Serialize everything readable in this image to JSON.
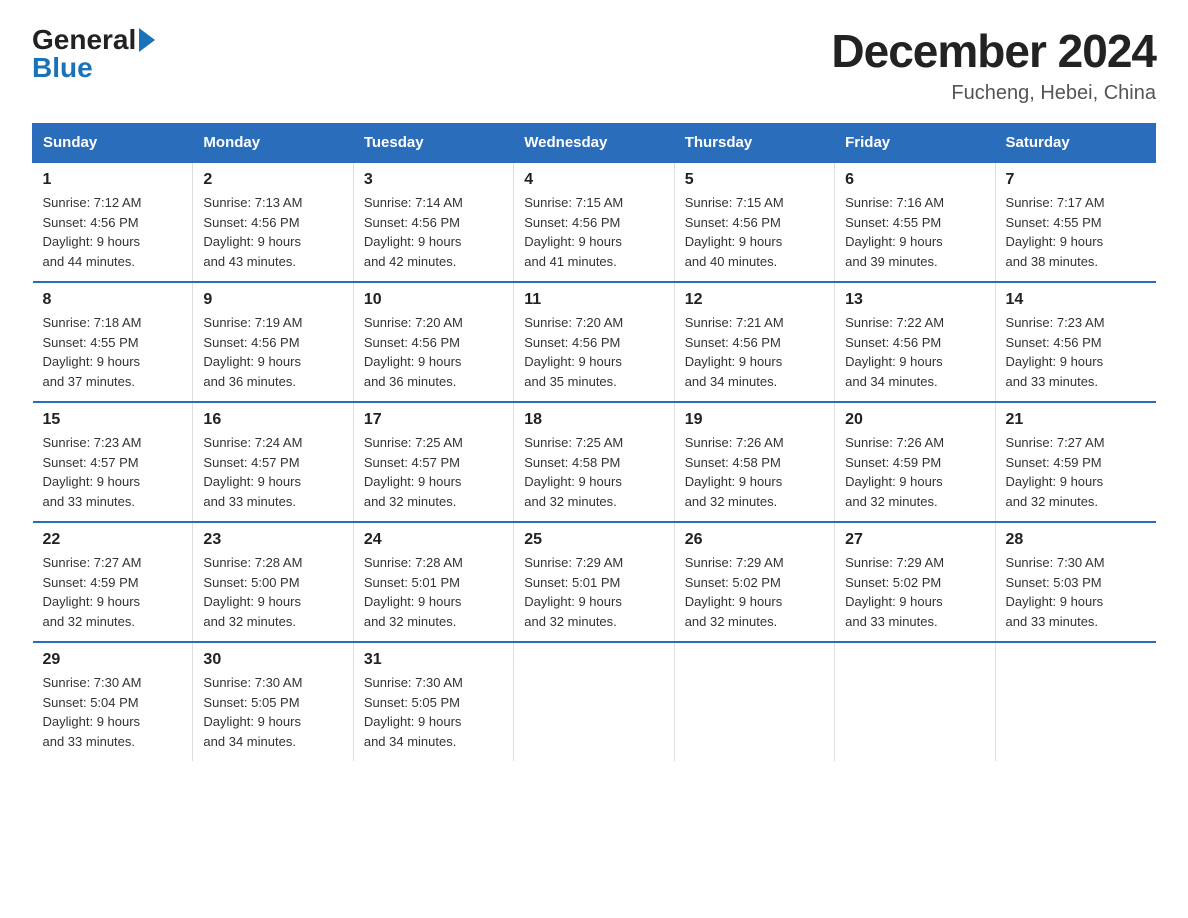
{
  "header": {
    "logo_general": "General",
    "logo_blue": "Blue",
    "month_title": "December 2024",
    "location": "Fucheng, Hebei, China"
  },
  "weekdays": [
    "Sunday",
    "Monday",
    "Tuesday",
    "Wednesday",
    "Thursday",
    "Friday",
    "Saturday"
  ],
  "weeks": [
    [
      {
        "day": "1",
        "sunrise": "7:12 AM",
        "sunset": "4:56 PM",
        "daylight": "9 hours and 44 minutes."
      },
      {
        "day": "2",
        "sunrise": "7:13 AM",
        "sunset": "4:56 PM",
        "daylight": "9 hours and 43 minutes."
      },
      {
        "day": "3",
        "sunrise": "7:14 AM",
        "sunset": "4:56 PM",
        "daylight": "9 hours and 42 minutes."
      },
      {
        "day": "4",
        "sunrise": "7:15 AM",
        "sunset": "4:56 PM",
        "daylight": "9 hours and 41 minutes."
      },
      {
        "day": "5",
        "sunrise": "7:15 AM",
        "sunset": "4:56 PM",
        "daylight": "9 hours and 40 minutes."
      },
      {
        "day": "6",
        "sunrise": "7:16 AM",
        "sunset": "4:55 PM",
        "daylight": "9 hours and 39 minutes."
      },
      {
        "day": "7",
        "sunrise": "7:17 AM",
        "sunset": "4:55 PM",
        "daylight": "9 hours and 38 minutes."
      }
    ],
    [
      {
        "day": "8",
        "sunrise": "7:18 AM",
        "sunset": "4:55 PM",
        "daylight": "9 hours and 37 minutes."
      },
      {
        "day": "9",
        "sunrise": "7:19 AM",
        "sunset": "4:56 PM",
        "daylight": "9 hours and 36 minutes."
      },
      {
        "day": "10",
        "sunrise": "7:20 AM",
        "sunset": "4:56 PM",
        "daylight": "9 hours and 36 minutes."
      },
      {
        "day": "11",
        "sunrise": "7:20 AM",
        "sunset": "4:56 PM",
        "daylight": "9 hours and 35 minutes."
      },
      {
        "day": "12",
        "sunrise": "7:21 AM",
        "sunset": "4:56 PM",
        "daylight": "9 hours and 34 minutes."
      },
      {
        "day": "13",
        "sunrise": "7:22 AM",
        "sunset": "4:56 PM",
        "daylight": "9 hours and 34 minutes."
      },
      {
        "day": "14",
        "sunrise": "7:23 AM",
        "sunset": "4:56 PM",
        "daylight": "9 hours and 33 minutes."
      }
    ],
    [
      {
        "day": "15",
        "sunrise": "7:23 AM",
        "sunset": "4:57 PM",
        "daylight": "9 hours and 33 minutes."
      },
      {
        "day": "16",
        "sunrise": "7:24 AM",
        "sunset": "4:57 PM",
        "daylight": "9 hours and 33 minutes."
      },
      {
        "day": "17",
        "sunrise": "7:25 AM",
        "sunset": "4:57 PM",
        "daylight": "9 hours and 32 minutes."
      },
      {
        "day": "18",
        "sunrise": "7:25 AM",
        "sunset": "4:58 PM",
        "daylight": "9 hours and 32 minutes."
      },
      {
        "day": "19",
        "sunrise": "7:26 AM",
        "sunset": "4:58 PM",
        "daylight": "9 hours and 32 minutes."
      },
      {
        "day": "20",
        "sunrise": "7:26 AM",
        "sunset": "4:59 PM",
        "daylight": "9 hours and 32 minutes."
      },
      {
        "day": "21",
        "sunrise": "7:27 AM",
        "sunset": "4:59 PM",
        "daylight": "9 hours and 32 minutes."
      }
    ],
    [
      {
        "day": "22",
        "sunrise": "7:27 AM",
        "sunset": "4:59 PM",
        "daylight": "9 hours and 32 minutes."
      },
      {
        "day": "23",
        "sunrise": "7:28 AM",
        "sunset": "5:00 PM",
        "daylight": "9 hours and 32 minutes."
      },
      {
        "day": "24",
        "sunrise": "7:28 AM",
        "sunset": "5:01 PM",
        "daylight": "9 hours and 32 minutes."
      },
      {
        "day": "25",
        "sunrise": "7:29 AM",
        "sunset": "5:01 PM",
        "daylight": "9 hours and 32 minutes."
      },
      {
        "day": "26",
        "sunrise": "7:29 AM",
        "sunset": "5:02 PM",
        "daylight": "9 hours and 32 minutes."
      },
      {
        "day": "27",
        "sunrise": "7:29 AM",
        "sunset": "5:02 PM",
        "daylight": "9 hours and 33 minutes."
      },
      {
        "day": "28",
        "sunrise": "7:30 AM",
        "sunset": "5:03 PM",
        "daylight": "9 hours and 33 minutes."
      }
    ],
    [
      {
        "day": "29",
        "sunrise": "7:30 AM",
        "sunset": "5:04 PM",
        "daylight": "9 hours and 33 minutes."
      },
      {
        "day": "30",
        "sunrise": "7:30 AM",
        "sunset": "5:05 PM",
        "daylight": "9 hours and 34 minutes."
      },
      {
        "day": "31",
        "sunrise": "7:30 AM",
        "sunset": "5:05 PM",
        "daylight": "9 hours and 34 minutes."
      },
      null,
      null,
      null,
      null
    ]
  ],
  "labels": {
    "sunrise": "Sunrise:",
    "sunset": "Sunset:",
    "daylight": "Daylight:"
  }
}
